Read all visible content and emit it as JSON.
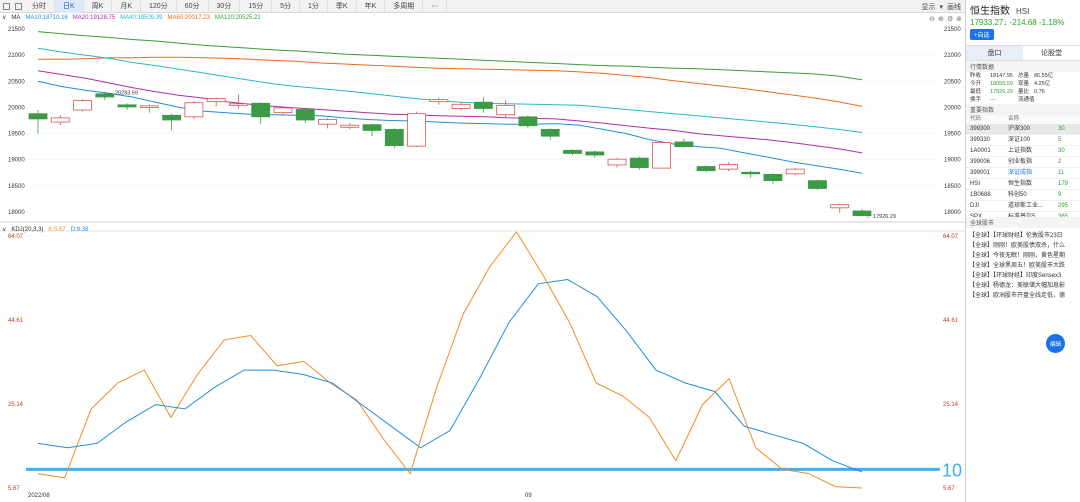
{
  "toolbar": {
    "periods": [
      "分时",
      "日K",
      "周K",
      "月K",
      "120分",
      "60分",
      "30分",
      "15分",
      "5分",
      "1分",
      "季K",
      "年K",
      "多周期",
      "⋯"
    ],
    "active_period": "日K",
    "right": {
      "show": "显示",
      "draw": "画线"
    }
  },
  "main_chart": {
    "indicator": "MA",
    "ma_labels": [
      {
        "text": "MA10:18710.16",
        "color": "#1f8fe0"
      },
      {
        "text": "MA20:19128.75",
        "color": "#b02cb0"
      },
      {
        "text": "MA40:19509.39",
        "color": "#2ab7c8"
      },
      {
        "text": "MA60:20017.23",
        "color": "#f06a1a"
      },
      {
        "text": "MA120:20525.22",
        "color": "#3a9a3a"
      }
    ],
    "y_ticks": [
      "21500",
      "21000",
      "20500",
      "20000",
      "19500",
      "19000",
      "18500",
      "18000"
    ],
    "high_label": "20283.59",
    "low_label": "17926.29"
  },
  "kdj": {
    "label": "KDJ(20,3,3)",
    "k_label": "K:5.67",
    "d_label": "D:9.38",
    "y_ticks": [
      "64.07",
      "44.61",
      "25.14",
      "5.67"
    ],
    "line_label": "10",
    "x_labels": [
      "2022/08",
      "09"
    ]
  },
  "chart_data": {
    "type": "candlestick",
    "title": "",
    "ylim": [
      17800,
      21600
    ],
    "candles": [
      [
        19880,
        19780,
        19500,
        19950
      ],
      [
        19720,
        19800,
        19660,
        19850
      ],
      [
        19950,
        20130,
        19920,
        20160
      ],
      [
        20260,
        20200,
        20140,
        20300
      ],
      [
        20050,
        20010,
        19950,
        20080
      ],
      [
        20000,
        20030,
        19900,
        20060
      ],
      [
        19850,
        19760,
        19560,
        19880
      ],
      [
        19820,
        20090,
        19780,
        20120
      ],
      [
        20110,
        20170,
        20020,
        20190
      ],
      [
        20040,
        20070,
        19980,
        20250
      ],
      [
        20080,
        19820,
        19690,
        20100
      ],
      [
        19900,
        19990,
        19850,
        20020
      ],
      [
        19960,
        19760,
        19700,
        19990
      ],
      [
        19680,
        19770,
        19600,
        19800
      ],
      [
        19620,
        19660,
        19580,
        19700
      ],
      [
        19670,
        19560,
        19450,
        19690
      ],
      [
        19580,
        19270,
        19220,
        19600
      ],
      [
        19260,
        19880,
        19240,
        19920
      ],
      [
        20110,
        20150,
        20050,
        20190
      ],
      [
        19980,
        20060,
        19940,
        20100
      ],
      [
        20100,
        19980,
        19900,
        20200
      ],
      [
        19860,
        20040,
        19820,
        20150
      ],
      [
        19820,
        19650,
        19600,
        19850
      ],
      [
        19580,
        19450,
        19380,
        19600
      ],
      [
        19180,
        19120,
        19080,
        19200
      ],
      [
        19150,
        19090,
        19040,
        19180
      ],
      [
        18900,
        19010,
        18850,
        19040
      ],
      [
        19030,
        18850,
        18810,
        19060
      ],
      [
        18840,
        19330,
        18830,
        19360
      ],
      [
        19340,
        19250,
        19230,
        19400
      ],
      [
        18870,
        18790,
        18760,
        18890
      ],
      [
        18820,
        18910,
        18780,
        18950
      ],
      [
        18760,
        18730,
        18660,
        18790
      ],
      [
        18720,
        18600,
        18540,
        18740
      ],
      [
        18730,
        18820,
        18700,
        18850
      ],
      [
        18600,
        18450,
        18420,
        18620
      ],
      [
        18080,
        18140,
        17980,
        18160
      ],
      [
        18020,
        17930,
        17926,
        18050
      ]
    ],
    "ma10": [
      20500,
      20400,
      20330,
      20270,
      20200,
      20100,
      20000,
      19930,
      19900,
      19870,
      19860,
      19850,
      19840,
      19800,
      19770,
      19750,
      19740,
      19720,
      19700,
      19690,
      19680,
      19680,
      19690,
      19660,
      19580,
      19500,
      19380,
      19300,
      19250,
      19220,
      19130,
      19050,
      18960,
      18890,
      18820,
      18740
    ],
    "ma20": [
      20700,
      20630,
      20560,
      20470,
      20380,
      20300,
      20230,
      20180,
      20110,
      20060,
      20020,
      19990,
      19960,
      19930,
      19900,
      19870,
      19860,
      19840,
      19830,
      19820,
      19800,
      19790,
      19780,
      19740,
      19700,
      19650,
      19600,
      19560,
      19500,
      19460,
      19420,
      19380,
      19330,
      19270,
      19210,
      19130
    ],
    "ma40": [
      21130,
      21060,
      21000,
      20940,
      20860,
      20800,
      20730,
      20660,
      20590,
      20520,
      20450,
      20400,
      20360,
      20320,
      20270,
      20220,
      20170,
      20130,
      20100,
      20080,
      20070,
      20060,
      20050,
      20040,
      20000,
      19960,
      19920,
      19880,
      19840,
      19800,
      19760,
      19720,
      19680,
      19630,
      19580,
      19520
    ],
    "ma60": [
      20920,
      20920,
      20930,
      20950,
      20950,
      20960,
      20960,
      20950,
      20940,
      20920,
      20900,
      20880,
      20850,
      20830,
      20810,
      20790,
      20770,
      20750,
      20740,
      20730,
      20720,
      20710,
      20700,
      20680,
      20650,
      20610,
      20570,
      20510,
      20460,
      20410,
      20360,
      20300,
      20240,
      20180,
      20110,
      20020
    ],
    "ma120": [
      21450,
      21410,
      21370,
      21340,
      21300,
      21270,
      21230,
      21190,
      21160,
      21130,
      21100,
      21080,
      21050,
      21020,
      21000,
      20980,
      20960,
      20940,
      20920,
      20900,
      20880,
      20860,
      20840,
      20820,
      20800,
      20790,
      20770,
      20750,
      20740,
      20720,
      20700,
      20680,
      20660,
      20640,
      20600,
      20530
    ],
    "kdj_k": [
      9,
      8,
      24,
      30,
      33,
      22,
      32,
      40,
      41,
      34,
      35,
      30,
      26,
      17,
      9,
      29,
      46,
      57,
      65,
      55,
      44,
      30,
      27,
      22,
      12,
      25,
      31,
      15,
      10,
      9,
      6,
      5.67
    ],
    "kdj_d": [
      16,
      15,
      16,
      21,
      25,
      24,
      29,
      33,
      33,
      32,
      30,
      25,
      20,
      15,
      19,
      31,
      44,
      53,
      54,
      50,
      42,
      33,
      30,
      28,
      20,
      18,
      16,
      12,
      9.38
    ],
    "kdj_ylim": [
      5.67,
      64.07
    ]
  },
  "panel": {
    "title": "恒生指数",
    "code": "HSI",
    "price": "17933.27↓",
    "change": "-214.68",
    "change_pct": "-1.18%",
    "add_label": "+自选",
    "tabs": [
      "盘口",
      "论股堂"
    ],
    "quote_title": "行情数据",
    "quote_rows": [
      [
        "昨收",
        "18147.95",
        "总量",
        "86.55亿"
      ],
      [
        "今开",
        "18055.59",
        "现量",
        "4.25亿"
      ],
      [
        "最低",
        "17926.29",
        "量比",
        "0.76"
      ],
      [
        "换手",
        "---",
        "流通值",
        ""
      ]
    ],
    "index_title": "重要指数",
    "index_head": [
      "代码",
      "名称",
      ""
    ],
    "index_rows": [
      {
        "code": "399300",
        "name": "沪深300",
        "val": "30",
        "sel": true
      },
      {
        "code": "399330",
        "name": "深证100",
        "val": "5"
      },
      {
        "code": "1A0001",
        "name": "上证指数",
        "val": "30"
      },
      {
        "code": "399006",
        "name": "创业板指",
        "val": "2"
      },
      {
        "code": "399001",
        "name": "深证成指",
        "val": "11",
        "blue": true
      },
      {
        "code": "HSI",
        "name": "恒生指数",
        "val": "179"
      },
      {
        "code": "1B0688",
        "name": "科创50",
        "val": "9"
      },
      {
        "code": "DJI",
        "name": "道琼斯工业...",
        "val": "295"
      },
      {
        "code": "SPX",
        "name": "标准普尔5...",
        "val": "365"
      }
    ],
    "news_title": "全球股市",
    "news": [
      "【全球】【环球财经】伦敦股市23日",
      "【全球】刚刚！欧美股债双杀，什么",
      "【全球】今夜无眠！刚刚，黄色星期",
      "【全球】全球黑周五！欧美股市大跌",
      "【全球】【环球财经】印度Sensex3",
      "【全球】杨德龙：美联储大幅加息影",
      "【全球】欧洲股市开盘全线走低，德"
    ],
    "edit_label": "编辑"
  }
}
